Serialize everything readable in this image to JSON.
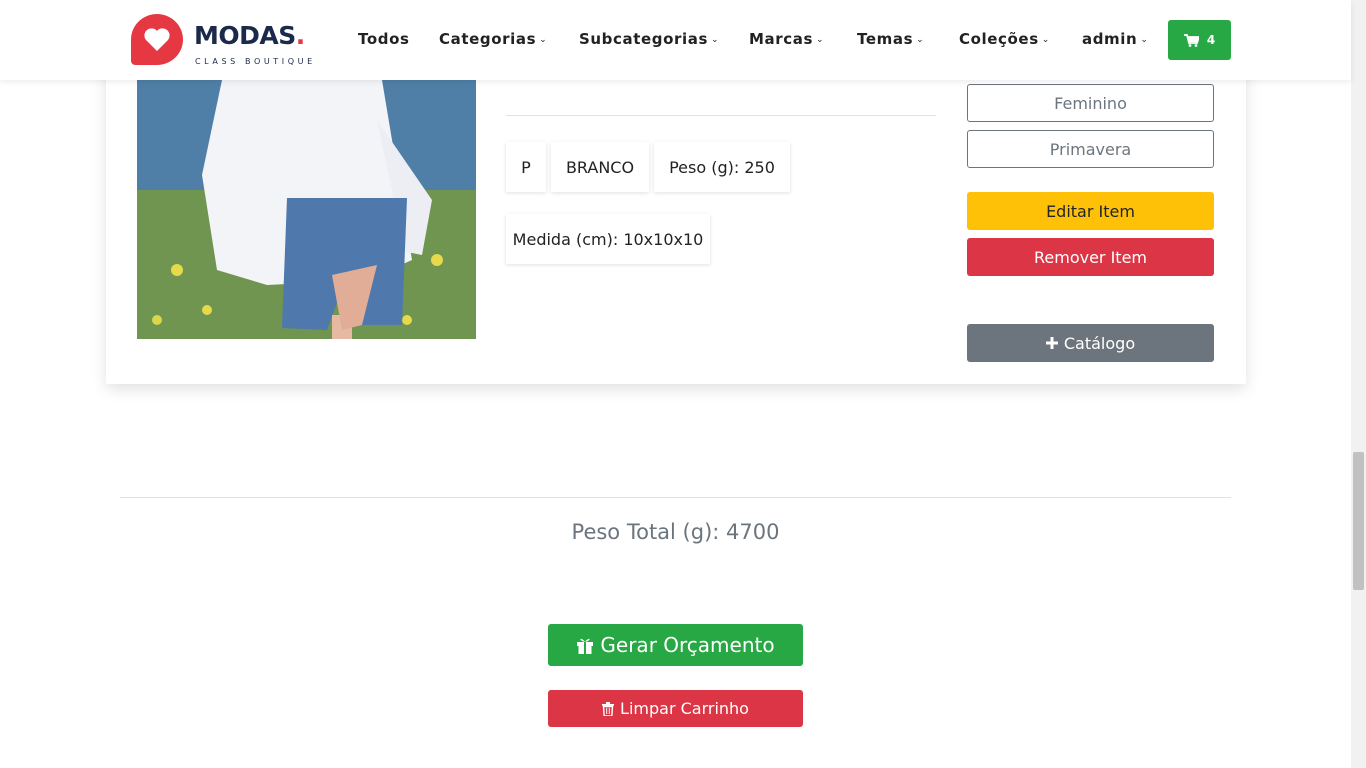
{
  "brand": {
    "name": "MODAS",
    "dot": ".",
    "tagline": "CLASS BOUTIQUE",
    "accent_color": "#e53843"
  },
  "nav": {
    "items": [
      {
        "label": "Todos",
        "dropdown": false
      },
      {
        "label": "Categorias",
        "dropdown": true
      },
      {
        "label": "Subcategorias",
        "dropdown": true
      },
      {
        "label": "Marcas",
        "dropdown": true
      },
      {
        "label": "Temas",
        "dropdown": true
      },
      {
        "label": "Coleções",
        "dropdown": true
      },
      {
        "label": "admin",
        "dropdown": true
      }
    ],
    "cart_count": "4",
    "cart_icon": "shopping-cart-icon",
    "chevron_icon": "chevron-down-icon"
  },
  "product": {
    "image_icon": "product-photo",
    "tags": [
      "P",
      "BRANCO",
      "Peso (g): 250",
      "Medida (cm): 10x10x10"
    ],
    "badges": [
      "Feminino",
      "Primavera"
    ],
    "edit_label": "Editar Item",
    "remove_label": "Remover Item",
    "catalog_label": "Catálogo",
    "catalog_icon": "plus-icon"
  },
  "summary": {
    "total_weight": "Peso Total (g): 4700",
    "quote_label": "Gerar Orçamento",
    "quote_icon": "gift-icon",
    "clear_label": "Limpar Carrinho",
    "clear_icon": "trash-icon"
  },
  "colors": {
    "success": "#28a745",
    "danger": "#dc3545",
    "warning": "#ffc107",
    "secondary": "#6c757d"
  }
}
